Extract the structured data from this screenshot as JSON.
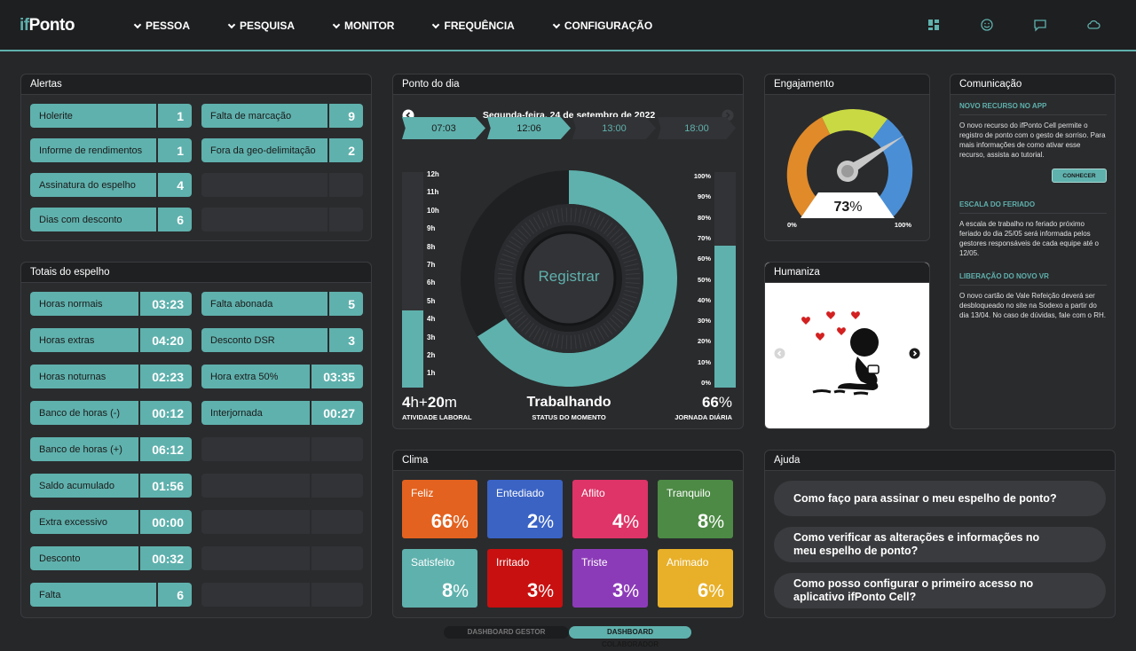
{
  "app": {
    "logo_prefix": "if",
    "logo_main": "Ponto"
  },
  "nav": [
    "PESSOA",
    "PESQUISA",
    "MONITOR",
    "FREQUÊNCIA",
    "CONFIGURAÇÃO"
  ],
  "alertas": {
    "title": "Alertas",
    "items": [
      {
        "label": "Holerite",
        "value": "1"
      },
      {
        "label": "Falta de marcação",
        "value": "9"
      },
      {
        "label": "Informe de rendimentos",
        "value": "1"
      },
      {
        "label": "Fora da geo-delimitação",
        "value": "2"
      },
      {
        "label": "Assinatura do espelho",
        "value": "4"
      },
      {
        "label": "",
        "value": ""
      },
      {
        "label": "Dias com desconto",
        "value": "6"
      },
      {
        "label": "",
        "value": ""
      }
    ]
  },
  "totais": {
    "title": "Totais do espelho",
    "left": [
      {
        "label": "Horas normais",
        "value": "03:23"
      },
      {
        "label": "Horas extras",
        "value": "04:20"
      },
      {
        "label": "Horas noturnas",
        "value": "02:23"
      },
      {
        "label": "Banco de horas (-)",
        "value": "00:12"
      },
      {
        "label": "Banco de horas (+)",
        "value": "06:12"
      },
      {
        "label": "Saldo acumulado",
        "value": "01:56"
      },
      {
        "label": "Extra excessivo",
        "value": "00:00"
      },
      {
        "label": "Desconto",
        "value": "00:32"
      },
      {
        "label": "Falta",
        "value": "6"
      }
    ],
    "right": [
      {
        "label": "Falta abonada",
        "value": "5"
      },
      {
        "label": "Desconto DSR",
        "value": "3"
      },
      {
        "label": "Hora extra 50%",
        "value": "03:35"
      },
      {
        "label": "Interjornada",
        "value": "00:27"
      }
    ]
  },
  "ponto": {
    "title": "Ponto do dia",
    "date": "Segunda-feira, 24 de setembro de 2022",
    "times": [
      "07:03",
      "12:06",
      "13:00",
      "18:00"
    ],
    "hours_scale": [
      "12h",
      "11h",
      "10h",
      "9h",
      "8h",
      "7h",
      "6h",
      "5h",
      "4h",
      "3h",
      "2h",
      "1h"
    ],
    "pct_scale": [
      "100%",
      "90%",
      "80%",
      "70%",
      "60%",
      "50%",
      "40%",
      "30%",
      "20%",
      "10%",
      "0%"
    ],
    "button": "Registrar",
    "activity_h": "4",
    "activity_h_unit": "h+",
    "activity_m": "20",
    "activity_m_unit": "m",
    "activity_label": "ATIVIDADE LABORAL",
    "status": "Trabalhando",
    "status_label": "STATUS DO MOMENTO",
    "journey": "66",
    "journey_unit": "%",
    "journey_label": "JORNADA DIÁRIA",
    "activity_fraction": 0.36,
    "journey_fraction": 0.66
  },
  "engajamento": {
    "title": "Engajamento",
    "value": "73",
    "unit": "%",
    "min": "0%",
    "max": "100%",
    "level": 0.73
  },
  "humaniza": {
    "title": "Humaniza"
  },
  "comunicacao": {
    "title": "Comunicação",
    "sections": [
      {
        "heading": "NOVO RECURSO NO APP",
        "text": "O novo recurso do ifPonto Cell permite o registro de ponto com o gesto de sorriso. Para mais informações de como ativar esse recurso, assista ao tutorial.",
        "button": "CONHECER"
      },
      {
        "heading": "ESCALA DO FERIADO",
        "text": "A escala de trabalho no feriado próximo feriado do dia 25/05 será informada pelos gestores responsáveis de cada equipe até o 12/05."
      },
      {
        "heading": "LIBERAÇÃO DO NOVO VR",
        "text": "O novo cartão de Vale Refeição deverá ser desbloqueado no site na Sodexo a partir do dia 13/04. No caso de dúvidas, fale com o RH."
      }
    ]
  },
  "clima": {
    "title": "Clima",
    "items": [
      {
        "name": "Feliz",
        "value": "66",
        "unit": "%",
        "color": "#e3621f"
      },
      {
        "name": "Entediado",
        "value": "2",
        "unit": "%",
        "color": "#3a63c4"
      },
      {
        "name": "Aflito",
        "value": "4",
        "unit": "%",
        "color": "#de3468"
      },
      {
        "name": "Tranquilo",
        "value": "8",
        "unit": "%",
        "color": "#4d8a45"
      },
      {
        "name": "Satisfeito",
        "value": "8",
        "unit": "%",
        "color": "#5fb1ad"
      },
      {
        "name": "Irritado",
        "value": "3",
        "unit": "%",
        "color": "#c81010"
      },
      {
        "name": "Triste",
        "value": "3",
        "unit": "%",
        "color": "#8c3bb8"
      },
      {
        "name": "Animado",
        "value": "6",
        "unit": "%",
        "color": "#e8b029"
      }
    ]
  },
  "ajuda": {
    "title": "Ajuda",
    "questions": [
      "Como faço para assinar o meu espelho de ponto?",
      "Como verificar as alterações e informações no meu espelho de ponto?",
      "Como posso configurar o primeiro acesso no aplicativo ifPonto Cell?"
    ]
  },
  "tabs": [
    "DASHBOARD GESTOR",
    "DASHBOARD COLABORADOR"
  ],
  "colors": {
    "accent": "#5fb1ad",
    "bg": "#262729",
    "panel": "#2a2b2d"
  }
}
